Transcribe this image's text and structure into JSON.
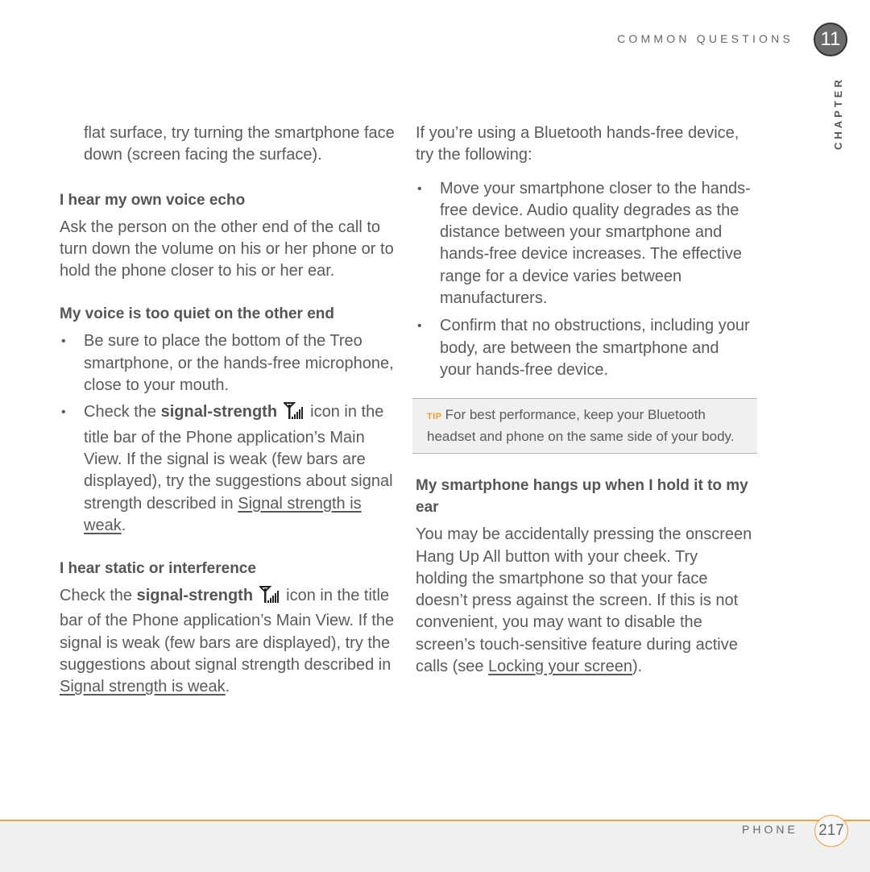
{
  "header": {
    "section_title": "COMMON QUESTIONS",
    "chapter_number": "11",
    "chapter_label": "CHAPTER"
  },
  "left_column": {
    "intro_continuation": "flat surface, try turning the smartphone face down (screen facing the surface).",
    "sections": [
      {
        "heading": "I hear my own voice echo",
        "body": "Ask the person on the other end of the call to turn down the volume on his or her phone or to hold the phone closer to his or her ear."
      },
      {
        "heading": "My voice is too quiet on the other end",
        "bullets": [
          {
            "text": "Be sure to place the bottom of the Treo smartphone, or the hands-free microphone, close to your mouth."
          },
          {
            "prefix": "Check the ",
            "bold": "signal-strength",
            "icon": "signal-strength-icon",
            "after_icon": " icon in the title bar of the Phone application’s Main View. If the signal is weak (few bars are displayed), try the suggestions about signal strength described in ",
            "link": "Signal strength is weak",
            "suffix": "."
          }
        ]
      },
      {
        "heading": "I hear static or interference",
        "prefix": "Check the ",
        "bold": "signal-strength",
        "icon": "signal-strength-icon",
        "after_icon": " icon in the title bar of the Phone application’s Main View. If the signal is weak (few bars are displayed), try the suggestions about signal strength described in ",
        "link": "Signal strength is weak",
        "suffix": "."
      }
    ]
  },
  "right_column": {
    "intro": "If you’re using a Bluetooth hands-free device, try the following:",
    "bullets": [
      "Move your smartphone closer to the hands-free device. Audio quality degrades as the distance between your smartphone and hands-free device increases. The effective range for a device varies between manufacturers.",
      "Confirm that no obstructions, including your body, are between the smartphone and your hands-free device."
    ],
    "tip": {
      "label": "TIP",
      "text": "For best performance, keep your Bluetooth headset and phone on the same side of your body."
    },
    "section": {
      "heading": "My smartphone hangs up when I hold it to my ear",
      "body": "You may be accidentally pressing the onscreen Hang Up All button with your cheek. Try holding the smartphone so that your face doesn’t press against the screen. If this is not convenient, you may want to disable the screen’s touch-sensitive feature during active calls (see ",
      "link": "Locking your screen",
      "suffix": ")."
    }
  },
  "footer": {
    "label": "PHONE",
    "page_number": "217"
  },
  "colors": {
    "accent_orange": "#f39a2a",
    "text_gray": "#5a5a5a",
    "footer_bg": "#f0f0f0"
  }
}
